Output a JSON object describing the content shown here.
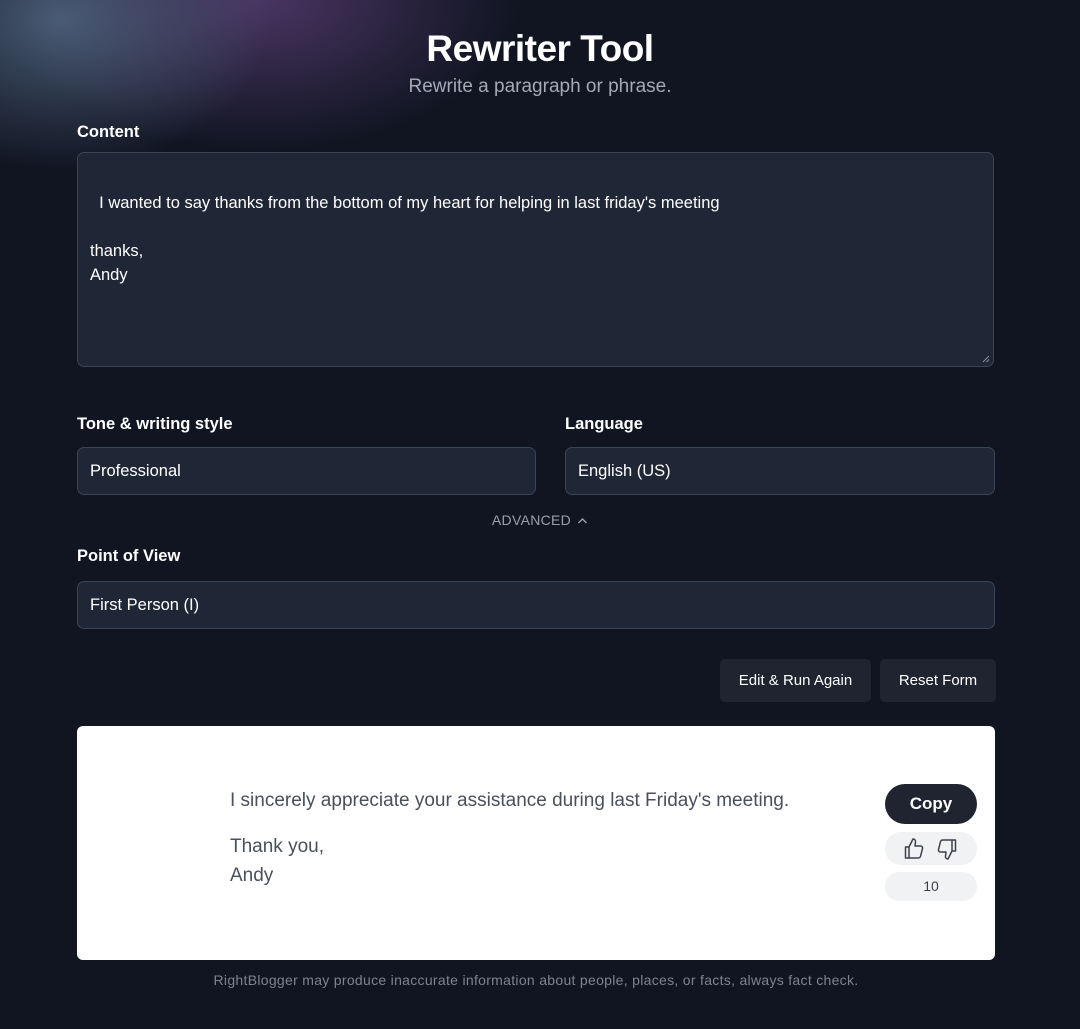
{
  "header": {
    "title": "Rewriter Tool",
    "subtitle": "Rewrite a paragraph or phrase."
  },
  "form": {
    "content_label": "Content",
    "content_value": "I wanted to say thanks from the bottom of my heart for helping in last friday's meeting\n\nthanks,\nAndy",
    "tone_label": "Tone & writing style",
    "tone_value": "Professional",
    "language_label": "Language",
    "language_value": "English (US)",
    "advanced_label": "ADVANCED",
    "pov_label": "Point of View",
    "pov_value": "First Person (I)"
  },
  "actions": {
    "edit_run_label": "Edit & Run Again",
    "reset_label": "Reset Form"
  },
  "output": {
    "line1": "I sincerely appreciate your assistance during last Friday's meeting.",
    "line2": "Thank you,",
    "line3": "Andy",
    "copy_label": "Copy",
    "count": "10"
  },
  "footer": {
    "disclaimer": "RightBlogger may produce inaccurate information about people, places, or facts, always fact check."
  },
  "icons": {
    "advanced": "chevron-up-icon",
    "like": "thumbs-up-icon",
    "dislike": "thumbs-down-icon",
    "resize": "resize-handle-icon"
  },
  "colors": {
    "background": "#111522",
    "field_background": "#1f2737",
    "field_border": "#3b4454",
    "button_dark": "#1f2430",
    "card_background": "#ffffff"
  }
}
